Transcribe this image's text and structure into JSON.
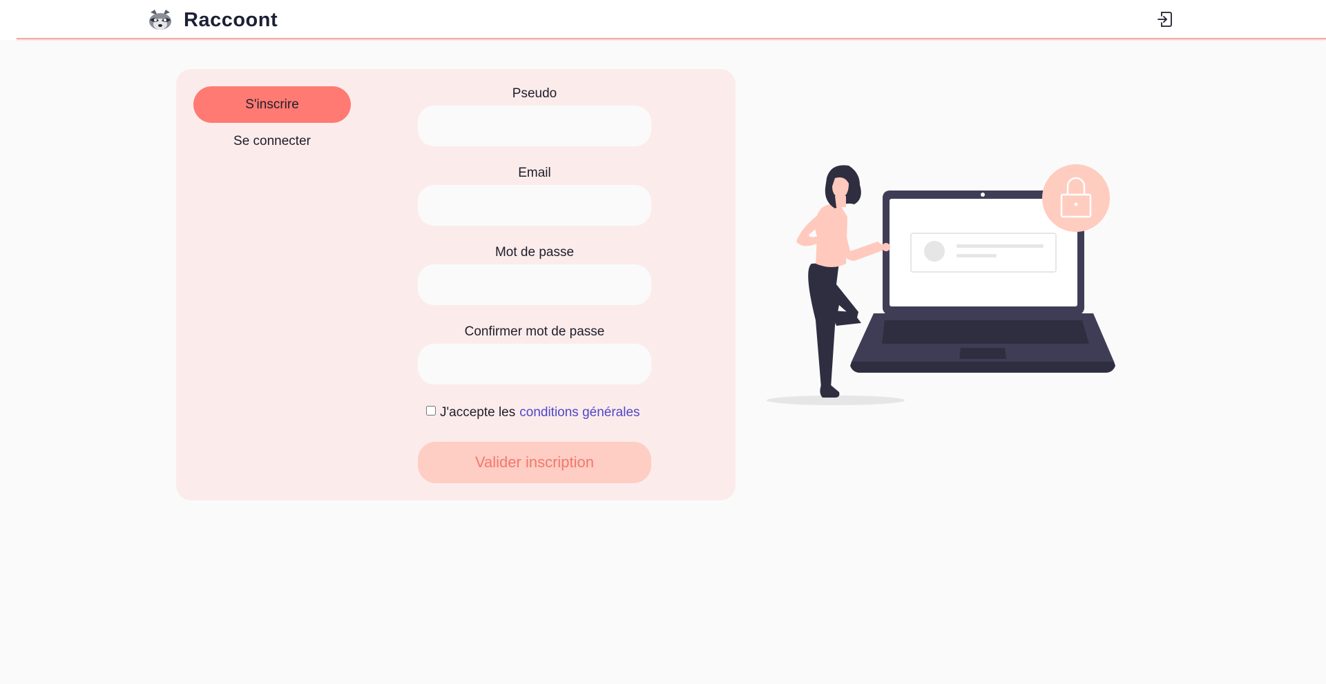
{
  "header": {
    "brand_name": "Raccoont",
    "logo_icon": "raccoon-logo-icon",
    "logout_icon": "sign-in-icon"
  },
  "tabs": {
    "signup_label": "S'inscrire",
    "login_label": "Se connecter"
  },
  "form": {
    "fields": [
      {
        "label": "Pseudo",
        "value": ""
      },
      {
        "label": "Email",
        "value": ""
      },
      {
        "label": "Mot de passe",
        "value": ""
      },
      {
        "label": "Confirmer mot de passe",
        "value": ""
      }
    ],
    "terms_prefix": "J'accepte les",
    "terms_link": "conditions générales",
    "terms_checked": false,
    "submit_label": "Valider inscription"
  },
  "illustration": {
    "icon": "woman-laptop-lock-illustration"
  },
  "colors": {
    "accent": "#ff7a72",
    "card_bg": "#fbeceb",
    "submit_bg": "#fecdc3",
    "submit_text": "#f2786e",
    "link": "#4f46c8",
    "dark": "#1f1d2b"
  }
}
